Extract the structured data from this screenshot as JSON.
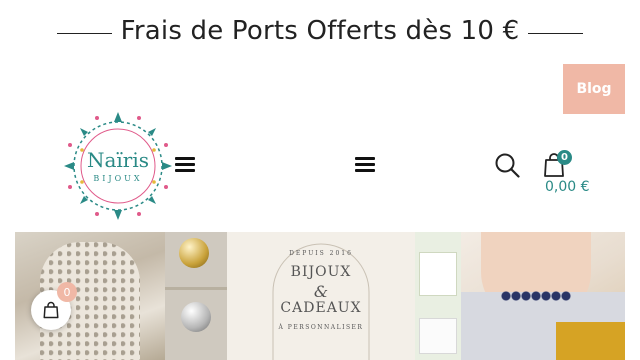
{
  "promo": {
    "text": "Frais de Ports Offerts dès 10 €"
  },
  "header": {
    "blog_label": "Blog",
    "logo": {
      "name": "Naïris",
      "sub": "BIJOUX"
    },
    "cart": {
      "count": "0",
      "total": "0,00 €"
    }
  },
  "banner": {
    "line1": "DEPUIS 2016",
    "line2": "BIJOUX",
    "line3": "&",
    "line4": "CADEAUX",
    "line5": "À PERSONNALISER"
  },
  "floating_cart": {
    "count": "0"
  },
  "colors": {
    "accent": "#2a8a86",
    "pink": "#f0b8a6",
    "text": "#222222"
  }
}
